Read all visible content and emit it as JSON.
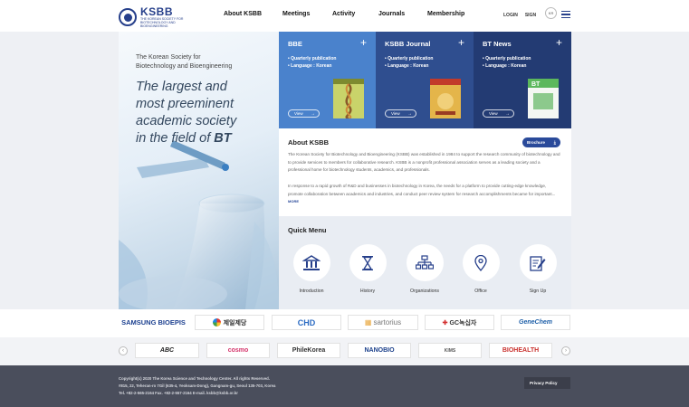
{
  "header": {
    "logo_name": "KSBB",
    "logo_sub": "THE KOREAN SOCIETY FOR BIOTECHNOLOGY AND BIOENGINEERING",
    "nav": [
      "About KSBB",
      "Meetings",
      "Activity",
      "Journals",
      "Membership"
    ],
    "login": "LOGIN",
    "sign": "SIGN",
    "kr": "KR"
  },
  "hero": {
    "org_line1": "The Korean Society for",
    "org_line2": "Biotechnology and Bioengineering",
    "head_line1": "The largest and",
    "head_line2": "most preeminent",
    "head_line3": "academic society",
    "head_line4_prefix": "in the field of ",
    "head_line4_bold": "BT"
  },
  "cards": [
    {
      "title": "BBE",
      "line1": "• Quarterly publication",
      "line2": "• Language : Korean",
      "view": "View",
      "color": "#4a82cc"
    },
    {
      "title": "KSBB Journal",
      "line1": "• Quarterly publication",
      "line2": "• Language : Korean",
      "view": "View",
      "color": "#2f4e8f"
    },
    {
      "title": "BT News",
      "line1": "• Quarterly publication",
      "line2": "• Language : Korean",
      "view": "View",
      "color": "#233b73"
    }
  ],
  "about": {
    "title": "About KSBB",
    "brochure": "Brochure",
    "p1": "The Korean Society for Biotechnology and Bioengineering (KSBB) was established in 1984 to support the research community of biotechnology and to provide services to members for collaborative research. KSBB is a nonprofit professional association serves as a leading society and a professional home for biotechnology students, academics, and professionals.",
    "p2": "In response to a rapid growth of R&D and businesses in biotechnology in Korea, the needs for a platform to provide cutting-edge knowledge, promote collaboration between academics and industries, and conduct peer review system for research accomplishments became for important...",
    "more": "MORE"
  },
  "quick": {
    "title": "Quick Menu",
    "items": [
      {
        "label": "Introduction",
        "icon": "building-icon"
      },
      {
        "label": "History",
        "icon": "hourglass-icon"
      },
      {
        "label": "Organizations",
        "icon": "org-chart-icon"
      },
      {
        "label": "Office",
        "icon": "map-pin-icon"
      },
      {
        "label": "Sign Up",
        "icon": "edit-document-icon"
      }
    ]
  },
  "partners_row1": [
    "SAMSUNG BIOEPIS",
    "제일제당",
    "CHD",
    "sartorius",
    "GC녹십자",
    "GeneChem"
  ],
  "partners_row2": [
    "ABC",
    "cosmo",
    "PhileKorea",
    "NANOBIO",
    "KIMS",
    "BIOHEALTH"
  ],
  "footer": {
    "line1": "Copyright(c) 2020 The Korea Science and Technology Center. All rights Reserved.",
    "line2": "#815, 22, Teheran-ro 7Gil (635-4, Yeoksam-Dong), Gangnam-gu, Seoul 135-703, Korea",
    "line3": "Tel. +82-2-565-2164  Fax. +82-2-557-2164  E-mail. ksbb@ksbb.or.kr",
    "privacy": "Privacy Policy"
  },
  "colors": {
    "brand": "#27408b",
    "footer_bg": "#4a4e5c"
  }
}
